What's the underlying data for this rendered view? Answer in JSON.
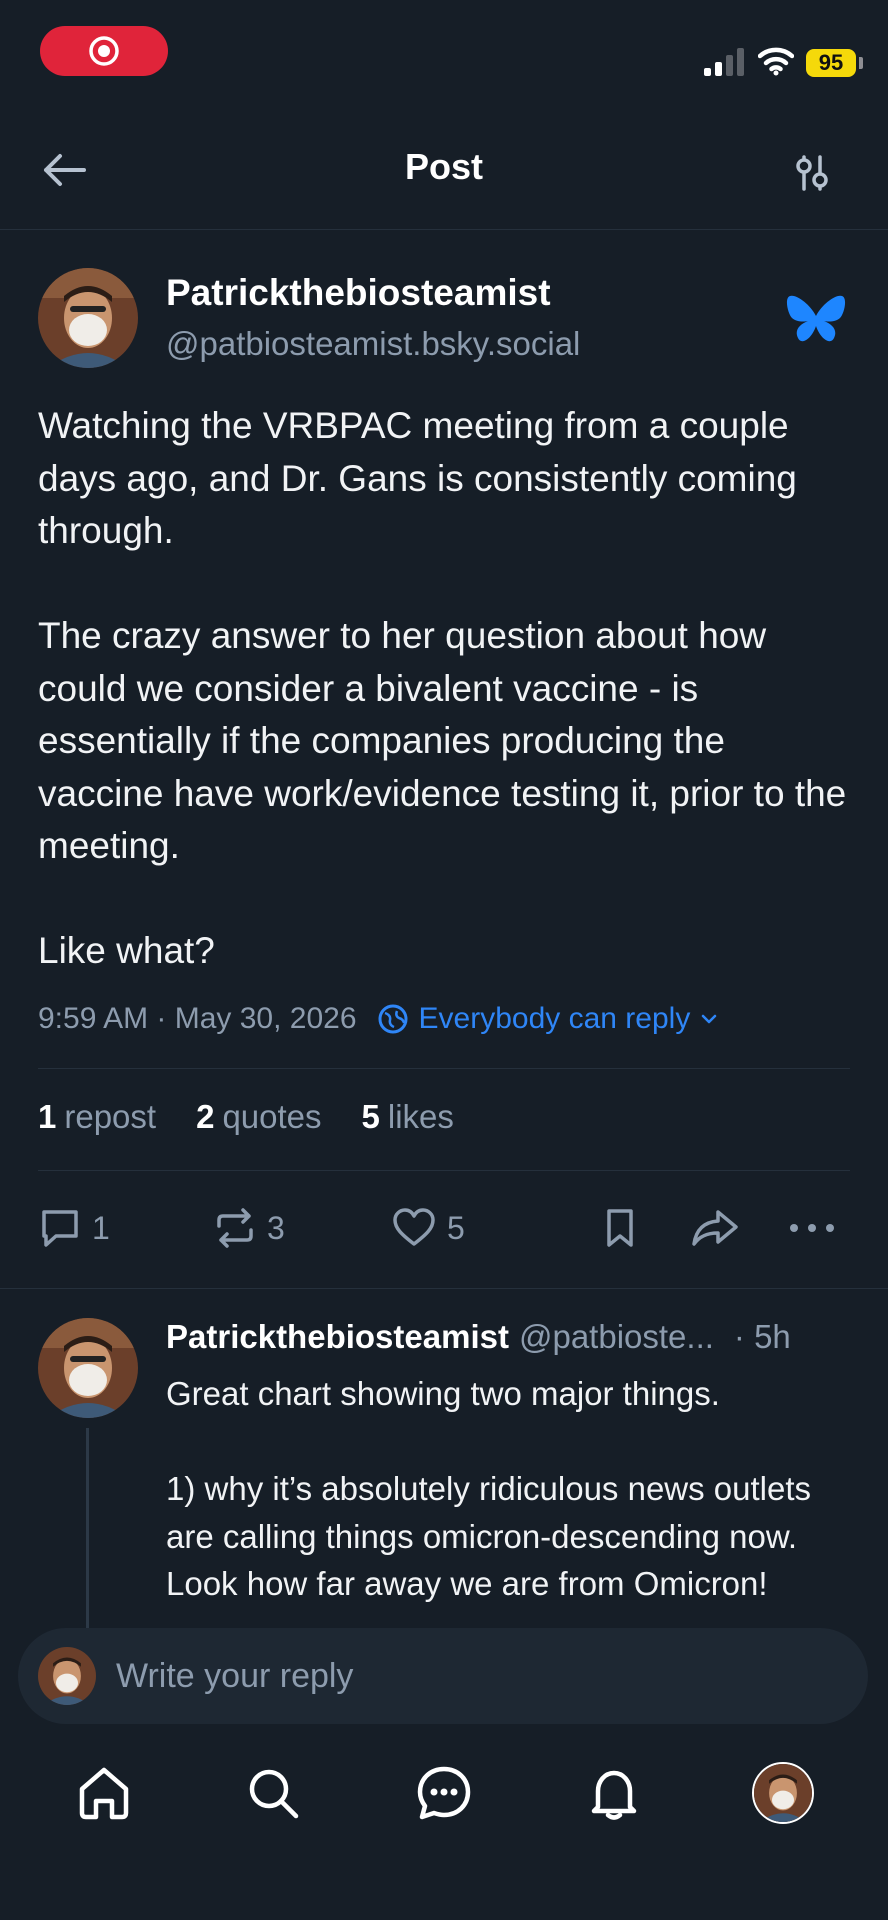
{
  "status_bar": {
    "battery_level": "95",
    "accent_color": "#e0243a"
  },
  "header": {
    "title": "Post",
    "back_icon": "arrow-left-icon",
    "filter_icon": "sliders-icon"
  },
  "post": {
    "author_name": "Patrickthebiosteamist",
    "author_handle": "@patbiosteamist.bsky.social",
    "badge_icon": "bluesky-butterfly-icon",
    "text": "Watching the VRBPAC meeting from a couple days ago, and Dr. Gans is consistently coming through.\n\nThe crazy answer to her question about how could we consider a bivalent vaccine - is essentially if the companies producing the vaccine have work/evidence testing it, prior to the meeting.\n\nLike what?",
    "timestamp": "9:59 AM · May 30, 2026",
    "reply_setting": "Everybody can reply",
    "stats": {
      "reposts_count": "1",
      "reposts_label": "repost",
      "quotes_count": "2",
      "quotes_label": "quotes",
      "likes_count": "5",
      "likes_label": "likes"
    },
    "actions": {
      "reply_count": "1",
      "repost_count": "3",
      "like_count": "5"
    }
  },
  "reply": {
    "author_name": "Patrickthebiosteamist",
    "author_handle": "@patbioste...",
    "time": "· 5h",
    "text": "Great chart showing two major things.\n\n1) why it’s absolutely ridiculous news outlets are calling things omicron-descending now. Look how far away we are from Omicron!"
  },
  "composer": {
    "placeholder": "Write your reply"
  },
  "nav": {
    "items": [
      "home-icon",
      "search-icon",
      "chat-icon",
      "bell-icon",
      "profile-avatar"
    ]
  },
  "colors": {
    "background": "#161e27",
    "link_blue": "#2f86f7",
    "muted_text": "#8d9cae"
  }
}
